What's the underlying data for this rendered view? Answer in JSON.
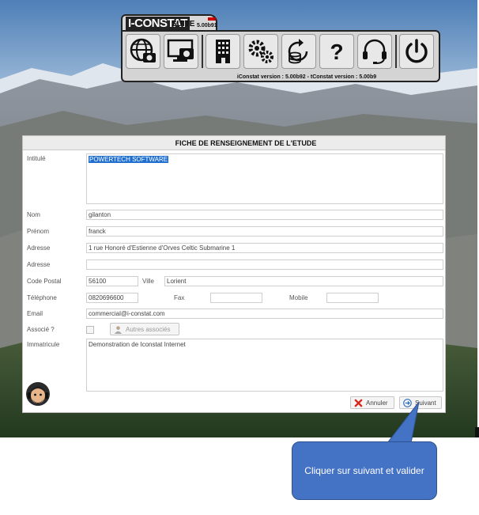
{
  "toolbar": {
    "logo_brand": "I-CONSTAT",
    "logo_suite": "SUITE",
    "logo_version": "5.00b91",
    "version_line": "iConstat version : 5.00b92 - tConstat version : 5.00b9",
    "buttons": [
      {
        "icon": "globe-camera-icon"
      },
      {
        "icon": "monitor-camera-icon"
      },
      {
        "icon": "building-icon"
      },
      {
        "icon": "gears-icon"
      },
      {
        "icon": "database-restore-icon"
      },
      {
        "icon": "help-icon"
      },
      {
        "icon": "headset-icon"
      },
      {
        "icon": "power-icon"
      }
    ]
  },
  "form": {
    "title": "FICHE DE RENSEIGNEMENT DE L'ETUDE",
    "intitule": {
      "label": "Intitulé",
      "value": "POWERTECH SOFTWARE"
    },
    "nom": {
      "label": "Nom",
      "value": "gilanton"
    },
    "prenom": {
      "label": "Prénom",
      "value": "franck"
    },
    "adresse1": {
      "label": "Adresse",
      "value": "1 rue Honoré d'Estienne d'Orves Celtic Submarine 1"
    },
    "adresse2": {
      "label": "Adresse",
      "value": ""
    },
    "code_postal": {
      "label": "Code Postal",
      "value": "56100"
    },
    "ville": {
      "label": "Ville",
      "value": "Lorient"
    },
    "telephone": {
      "label": "Téléphone",
      "value": "0820696600"
    },
    "fax": {
      "label": "Fax",
      "value": ""
    },
    "mobile": {
      "label": "Mobile",
      "value": ""
    },
    "email": {
      "label": "Email",
      "value": "commercial@i-constat.com"
    },
    "associe": {
      "label": "Associé ?",
      "button": "Autres associés"
    },
    "immatricule": {
      "label": "Immatricule",
      "value": "Demonstration de Iconstat Internet"
    },
    "annuler": "Annuler",
    "suivant": "Suivant"
  },
  "callout": {
    "text": "Cliquer sur suivant et valider"
  },
  "colors": {
    "callout": "#4472c4",
    "selection": "#1f6fd0",
    "annuler_icon": "#d9261c",
    "suivant_icon": "#2a6ebf"
  }
}
